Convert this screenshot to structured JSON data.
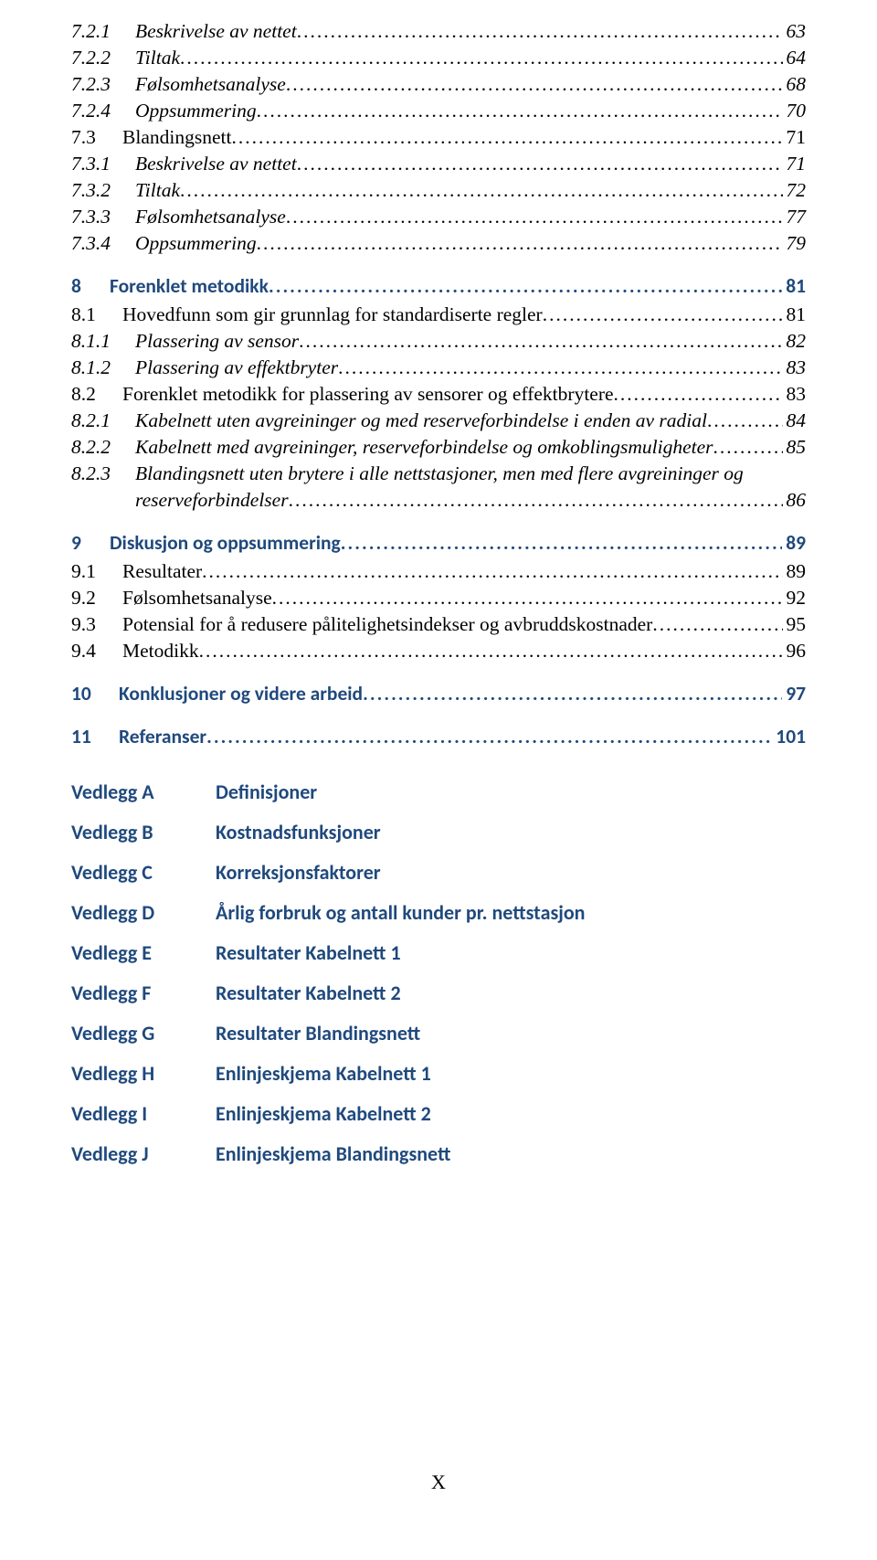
{
  "toc": [
    {
      "kind": "l3",
      "num": "7.2.1",
      "title": "Beskrivelse av nettet",
      "page": "63"
    },
    {
      "kind": "l3",
      "num": "7.2.2",
      "title": "Tiltak",
      "page": "64"
    },
    {
      "kind": "l3",
      "num": "7.2.3",
      "title": "Følsomhetsanalyse",
      "page": "68"
    },
    {
      "kind": "l3",
      "num": "7.2.4",
      "title": "Oppsummering",
      "page": "70"
    },
    {
      "kind": "l2",
      "num": "7.3",
      "title": "Blandingsnett",
      "page": "71"
    },
    {
      "kind": "l3",
      "num": "7.3.1",
      "title": "Beskrivelse av nettet",
      "page": "71"
    },
    {
      "kind": "l3",
      "num": "7.3.2",
      "title": "Tiltak",
      "page": "72"
    },
    {
      "kind": "l3",
      "num": "7.3.3",
      "title": "Følsomhetsanalyse",
      "page": "77"
    },
    {
      "kind": "l3",
      "num": "7.3.4",
      "title": "Oppsummering",
      "page": "79"
    },
    {
      "kind": "h1",
      "num": "8",
      "title": "Forenklet metodikk",
      "page": "81"
    },
    {
      "kind": "l2",
      "num": "8.1",
      "title": "Hovedfunn som gir grunnlag for standardiserte regler",
      "page": "81"
    },
    {
      "kind": "l3",
      "num": "8.1.1",
      "title": "Plassering av sensor",
      "page": "82"
    },
    {
      "kind": "l3",
      "num": "8.1.2",
      "title": "Plassering av effektbryter",
      "page": "83"
    },
    {
      "kind": "l2",
      "num": "8.2",
      "title": "Forenklet metodikk for plassering av sensorer og effektbrytere",
      "page": "83"
    },
    {
      "kind": "l3",
      "num": "8.2.1",
      "title": "Kabelnett uten avgreininger og med reserveforbindelse i enden av radial",
      "page": "84"
    },
    {
      "kind": "l3",
      "num": "8.2.2",
      "title": "Kabelnett med avgreininger, reserveforbindelse og omkoblingsmuligheter",
      "page": "85"
    },
    {
      "kind": "l3wrap",
      "num": "8.2.3",
      "title_line1": "Blandingsnett uten brytere i alle nettstasjoner, men med flere avgreininger og",
      "title_line2": "reserveforbindelser",
      "page": "86"
    },
    {
      "kind": "h1",
      "num": "9",
      "title": "Diskusjon og oppsummering",
      "page": "89"
    },
    {
      "kind": "l2",
      "num": "9.1",
      "title": "Resultater",
      "page": "89"
    },
    {
      "kind": "l2",
      "num": "9.2",
      "title": "Følsomhetsanalyse",
      "page": "92"
    },
    {
      "kind": "l2",
      "num": "9.3",
      "title": "Potensial for å redusere pålitelighetsindekser og avbruddskostnader",
      "page": "95"
    },
    {
      "kind": "l2",
      "num": "9.4",
      "title": "Metodikk",
      "page": "96"
    },
    {
      "kind": "h1w",
      "num": "10",
      "title": "Konklusjoner og videre arbeid",
      "page": "97"
    },
    {
      "kind": "h1w",
      "num": "11",
      "title": "Referanser",
      "page": "101"
    }
  ],
  "appendices": [
    {
      "key": "Vedlegg A",
      "val": "Definisjoner"
    },
    {
      "key": "Vedlegg B",
      "val": "Kostnadsfunksjoner"
    },
    {
      "key": "Vedlegg C",
      "val": "Korreksjonsfaktorer"
    },
    {
      "key": "Vedlegg D",
      "val": "Årlig forbruk og antall kunder pr. nettstasjon"
    },
    {
      "key": "Vedlegg E",
      "val": "Resultater Kabelnett 1"
    },
    {
      "key": "Vedlegg F",
      "val": "Resultater Kabelnett 2"
    },
    {
      "key": "Vedlegg G",
      "val": "Resultater Blandingsnett"
    },
    {
      "key": "Vedlegg H",
      "val": "Enlinjeskjema Kabelnett 1"
    },
    {
      "key": "Vedlegg I",
      "val": "Enlinjeskjema Kabelnett 2"
    },
    {
      "key": "Vedlegg J",
      "val": "Enlinjeskjema Blandingsnett"
    }
  ],
  "footer": "X"
}
